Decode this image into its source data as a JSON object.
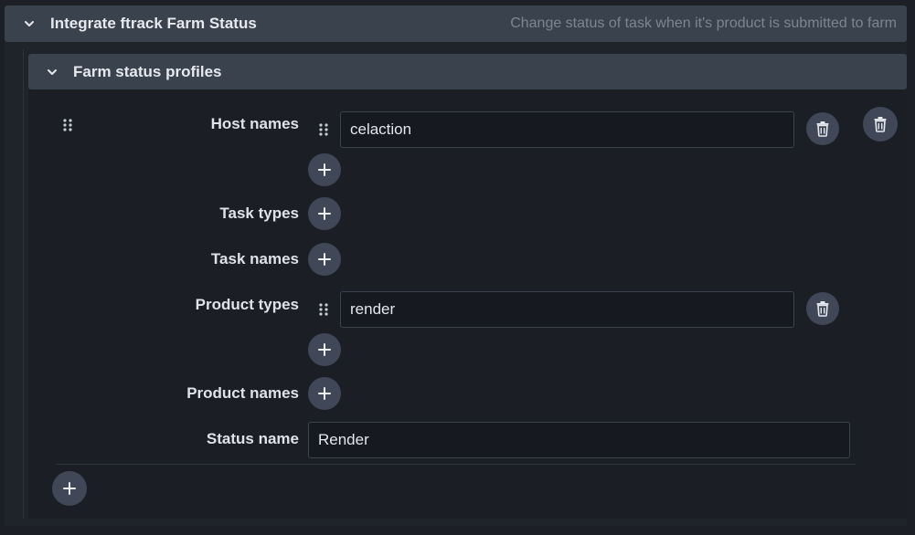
{
  "section": {
    "title": "Integrate ftrack Farm Status",
    "description": "Change status of task when it's product is submitted to farm",
    "chevron_icon": "chevron-down-icon"
  },
  "subsection": {
    "title": "Farm status profiles",
    "chevron_icon": "chevron-down-icon"
  },
  "profile": {
    "host_names": {
      "label": "Host names",
      "items": [
        "celaction"
      ]
    },
    "task_types": {
      "label": "Task types",
      "items": []
    },
    "task_names": {
      "label": "Task names",
      "items": []
    },
    "product_types": {
      "label": "Product types",
      "items": [
        "render"
      ]
    },
    "product_names": {
      "label": "Product names",
      "items": []
    },
    "status_name": {
      "label": "Status name",
      "value": "Render"
    }
  },
  "icons": {
    "add": "plus-icon",
    "delete": "trash-icon",
    "drag": "drag-handle-icon"
  },
  "colors": {
    "header_bg": "#3a424e",
    "body_bg": "#1b1f25",
    "button_bg": "#404857",
    "input_bg": "#161a20",
    "muted_text": "#7d8592"
  }
}
